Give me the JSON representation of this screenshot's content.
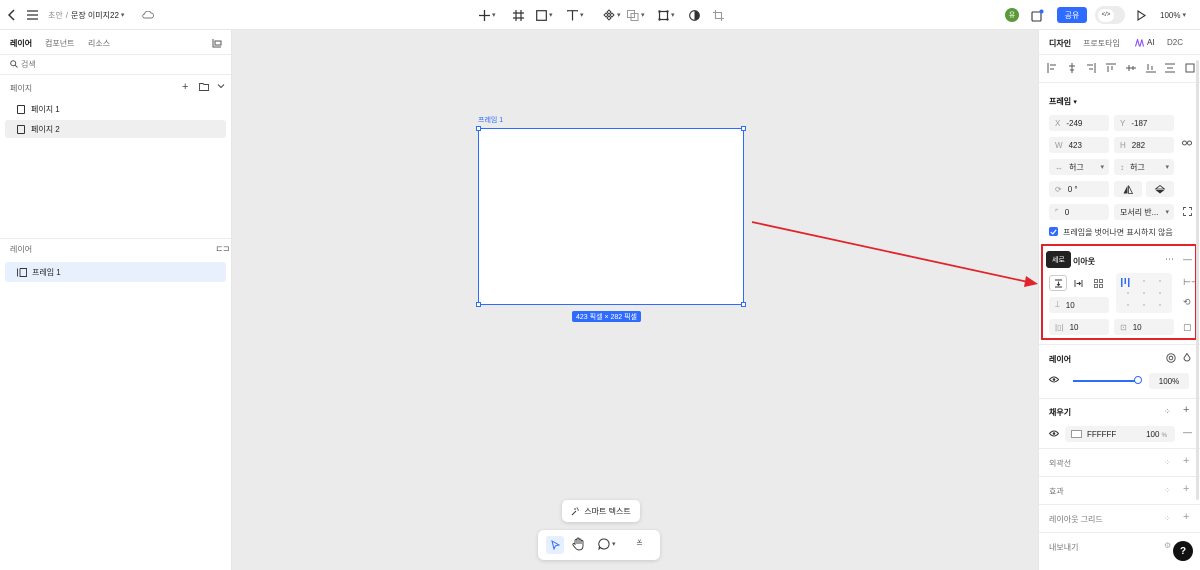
{
  "topbar": {
    "breadcrumb_prefix": "초안",
    "breadcrumb_sep": "/",
    "file_name": "문장 이미지22",
    "share_label": "공유",
    "zoom": "100%",
    "avatar_text": "유",
    "code_label": "</>"
  },
  "left": {
    "tabs": [
      "레이어",
      "컴포넌트",
      "리소스"
    ],
    "search_placeholder": "검색",
    "pages_title": "페이지",
    "pages": [
      "페이지 1",
      "페이지 2"
    ],
    "layers_title": "레이어",
    "layers": [
      "프레임 1"
    ]
  },
  "canvas": {
    "frame_label": "프레임 1",
    "size_badge": "423 픽셀 × 282 픽셀",
    "smart_text_label": "스마트 텍스트"
  },
  "right": {
    "tabs": [
      "디자인",
      "프로토타입",
      "AI",
      "D2C"
    ],
    "frame_title": "프레임",
    "x_label": "X",
    "x_value": "-249",
    "y_label": "Y",
    "y_value": "-187",
    "w_label": "W",
    "w_value": "423",
    "h_label": "H",
    "h_value": "282",
    "hug_w": "허그",
    "hug_h": "허그",
    "rotation": "0 °",
    "radius": "0",
    "corner_mode": "모서리 반...",
    "clip_label": "프레임을 벗어나면 표시하지 않음",
    "layout_title": "이아웃",
    "tooltip": "세로",
    "gap": "10",
    "pad_h": "10",
    "pad_v": "10",
    "layer_title": "레이어",
    "opacity": "100%",
    "fill_title": "채우기",
    "fill_hex": "FFFFFF",
    "fill_opacity": "100",
    "fill_pct": "%",
    "stroke_title": "외곽선",
    "effect_title": "효과",
    "grid_title": "레이아웃 그리드",
    "export_title": "내보내기",
    "help": "?"
  },
  "colors": {
    "accent": "#2f6bff",
    "highlight_box": "#e0242a",
    "arrow": "#e0242a",
    "avatar": "#5a9a3a"
  }
}
